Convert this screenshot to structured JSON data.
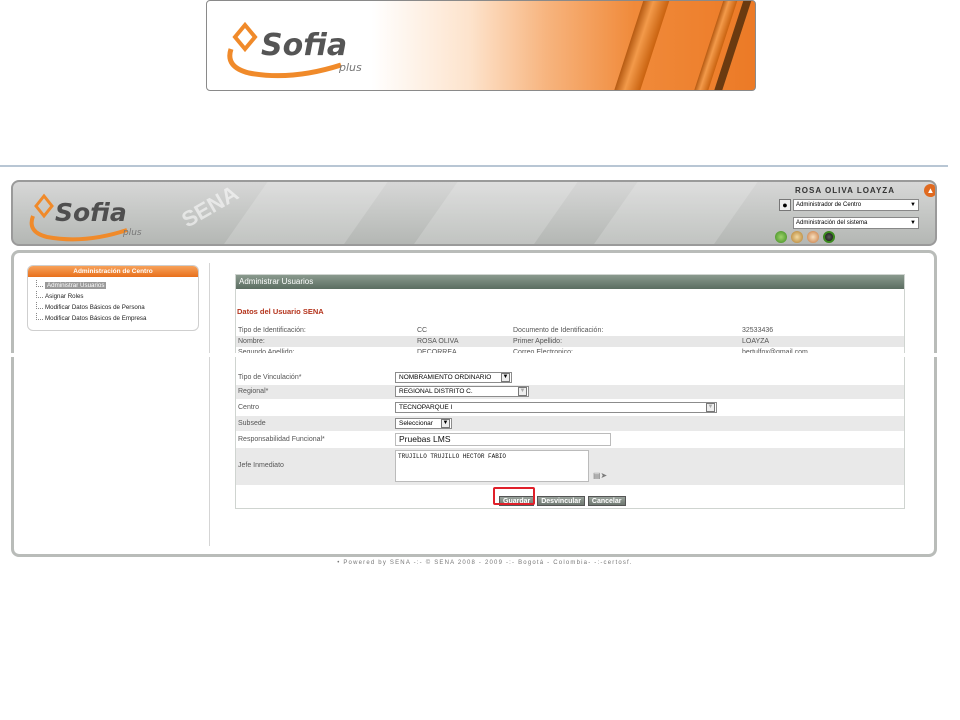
{
  "brand": {
    "name": "Sofia",
    "sub": "plus"
  },
  "header": {
    "user_name": "ROSA OLIVA LOAYZA",
    "role": "Administrador de Centro",
    "system": "Administración del sistema",
    "sena_mark": "SENA"
  },
  "sidebar": {
    "title": "Administración de Centro",
    "items": [
      {
        "label": "Administrar Usuarios"
      },
      {
        "label": "Asignar Roles"
      },
      {
        "label": "Modificar Datos Básicos de Persona"
      },
      {
        "label": "Modificar Datos Básicos de Empresa"
      }
    ]
  },
  "main": {
    "title": "Administrar Usuarios",
    "section": "Datos del Usuario SENA",
    "info": [
      {
        "l1": "Tipo de Identificación:",
        "v1": "CC",
        "l2": "Documento de Identificación:",
        "v2": "32533436"
      },
      {
        "l1": "Nombre:",
        "v1": "ROSA OLIVA",
        "l2": "Primer Apellido:",
        "v2": "LOAYZA"
      },
      {
        "l1": "Segundo Apellido:",
        "v1": "DECORREA",
        "l2": "Correo Electronico:",
        "v2": "bertulfox@gmail.com"
      }
    ],
    "form": {
      "vinculacion_label": "Tipo de Vinculación*",
      "vinculacion_value": "NOMBRAMIENTO ORDINARIO",
      "regional_label": "Regional*",
      "regional_value": "REGIONAL DISTRITO C.",
      "centro_label": "Centro",
      "centro_value": "TECNOPARQUE I",
      "subsede_label": "Subsede",
      "subsede_value": "Seleccionar",
      "responsabilidad_label": "Responsabilidad Funcional*",
      "responsabilidad_value": "Pruebas LMS",
      "jefe_label": "Jefe Inmediato",
      "jefe_value": "TRUJILLO TRUJILLO HECTOR FABIO"
    },
    "buttons": {
      "guardar": "Guardar",
      "desvincular": "Desvincular",
      "cancelar": "Cancelar"
    }
  },
  "footer": "• Powered by SENA -:- © SENA 2008 - 2009 -:- Bogotá - Colombia- -:-certosf."
}
